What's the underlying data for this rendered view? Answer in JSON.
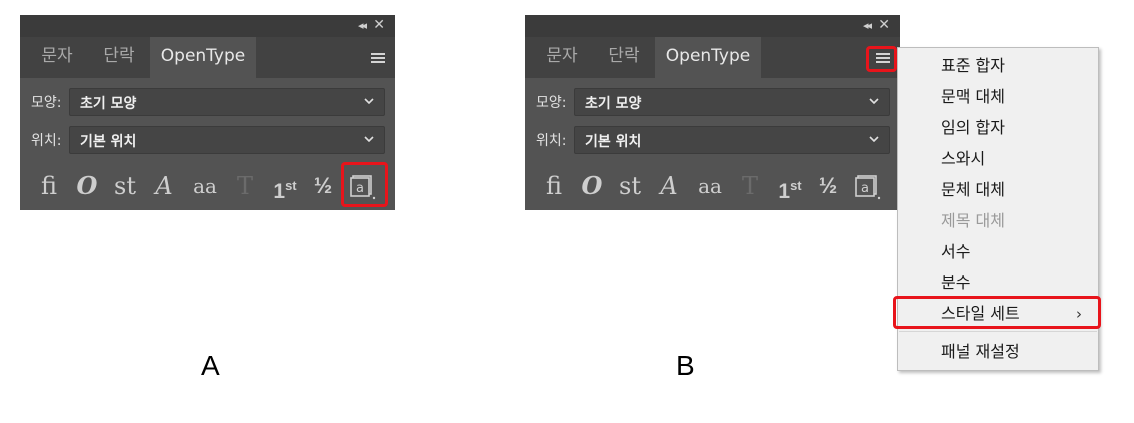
{
  "panel_a": {
    "tabs": [
      "문자",
      "단락",
      "OpenType"
    ],
    "shape": {
      "label": "모양:",
      "value": "초기 모양"
    },
    "position": {
      "label": "위치:",
      "value": "기본 위치"
    },
    "icons": [
      "fi-ligature-icon",
      "contextual-alternates-icon",
      "discretionary-ligature-icon",
      "swash-icon",
      "stylistic-alternates-icon",
      "titling-alternates-icon",
      "ordinals-icon",
      "fractions-icon",
      "stylistic-sets-icon"
    ],
    "icon_glyphs": {
      "ordinal_base": "1",
      "ordinal_sup": "st",
      "fraction": "½"
    },
    "caption": "A"
  },
  "panel_b": {
    "tabs": [
      "문자",
      "단락",
      "OpenType"
    ],
    "shape": {
      "label": "모양:",
      "value": "초기 모양"
    },
    "position": {
      "label": "위치:",
      "value": "기본 위치"
    },
    "caption": "B"
  },
  "menu": {
    "items": [
      {
        "label": "표준 합자",
        "enabled": true
      },
      {
        "label": "문맥 대체",
        "enabled": true
      },
      {
        "label": "임의 합자",
        "enabled": true
      },
      {
        "label": "스와시",
        "enabled": true
      },
      {
        "label": "문체 대체",
        "enabled": true
      },
      {
        "label": "제목 대체",
        "enabled": false
      },
      {
        "label": "서수",
        "enabled": true
      },
      {
        "label": "분수",
        "enabled": true
      },
      {
        "label": "스타일 세트",
        "enabled": true,
        "submenu": true
      }
    ],
    "reset_label": "패널 재설정",
    "submenu_arrow": "›"
  },
  "colors": {
    "panel_bg": "#535353",
    "tab_bar": "#424242",
    "highlight": "#e8141b",
    "menu_bg": "#f0f0f0"
  }
}
